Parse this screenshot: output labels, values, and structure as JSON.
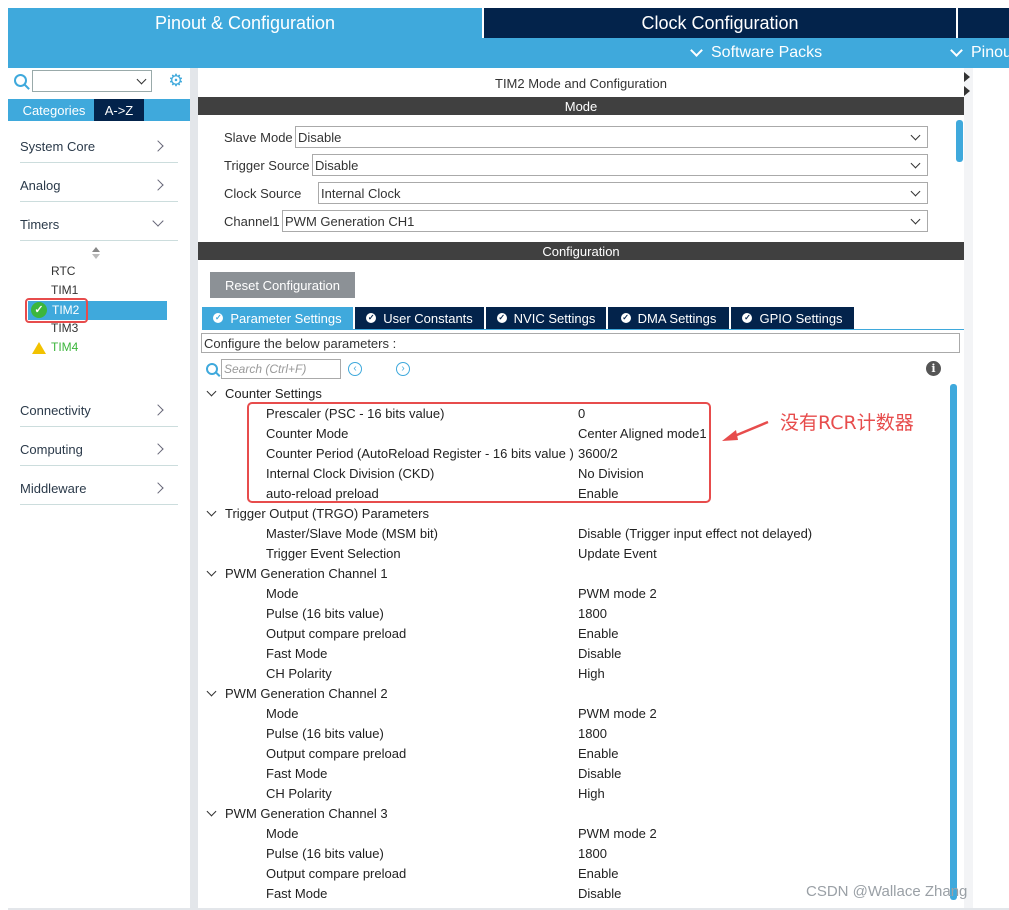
{
  "header": {
    "pinout_tab": "Pinout & Configuration",
    "clock_tab": "Clock Configuration",
    "software_packs": "Software Packs",
    "pinout_menu": "Pinout"
  },
  "sidebar": {
    "search_value": "",
    "tab_categories": "Categories",
    "tab_az": "A->Z",
    "items": {
      "system_core": "System Core",
      "analog": "Analog",
      "timers": "Timers",
      "connectivity": "Connectivity",
      "computing": "Computing",
      "middleware": "Middleware"
    },
    "timers": [
      "RTC",
      "TIM1",
      "TIM2",
      "TIM3",
      "TIM4"
    ]
  },
  "main": {
    "title": "TIM2 Mode and Configuration",
    "mode_header": "Mode",
    "mode": {
      "slave_mode_label": "Slave Mode",
      "slave_mode_value": "Disable",
      "trigger_source_label": "Trigger Source",
      "trigger_source_value": "Disable",
      "clock_source_label": "Clock Source",
      "clock_source_value": "Internal Clock",
      "channel1_label": "Channel1",
      "channel1_value": "PWM Generation CH1"
    },
    "config_header": "Configuration",
    "reset_button": "Reset Configuration",
    "tabs": {
      "parameter": "Parameter Settings",
      "user_constants": "User Constants",
      "nvic": "NVIC Settings",
      "dma": "DMA Settings",
      "gpio": "GPIO Settings"
    },
    "hint": "Configure the below parameters :",
    "search_placeholder": "Search (Ctrl+F)",
    "params": {
      "counter_settings": "Counter Settings",
      "prescaler_label": "Prescaler (PSC - 16 bits value)",
      "prescaler_value": "0",
      "counter_mode_label": "Counter Mode",
      "counter_mode_value": "Center Aligned mode1",
      "counter_period_label": "Counter Period (AutoReload Register - 16 bits value )",
      "counter_period_value": "3600/2",
      "ckd_label": "Internal Clock Division (CKD)",
      "ckd_value": "No Division",
      "arpe_label": "auto-reload preload",
      "arpe_value": "Enable",
      "trgo": "Trigger Output (TRGO) Parameters",
      "msm_label": "Master/Slave Mode (MSM bit)",
      "msm_value": "Disable (Trigger input effect not delayed)",
      "trig_evt_label": "Trigger Event Selection",
      "trig_evt_value": "Update Event",
      "pwm1": "PWM Generation Channel 1",
      "pwm2": "PWM Generation Channel 2",
      "pwm3": "PWM Generation Channel 3",
      "mode_label": "Mode",
      "mode_value": "PWM mode 2",
      "pulse_label": "Pulse (16 bits value)",
      "pulse_value": "1800",
      "ocpre_label": "Output compare preload",
      "ocpre_value": "Enable",
      "fast_label": "Fast Mode",
      "fast_value": "Disable",
      "pol_label": "CH Polarity",
      "pol_value": "High"
    }
  },
  "annotation": "没有RCR计数器",
  "watermark": "CSDN @Wallace Zhang",
  "colors": {
    "accent": "#3fa9dc",
    "navy": "#03234b",
    "annotation_red": "#e74c4c"
  }
}
